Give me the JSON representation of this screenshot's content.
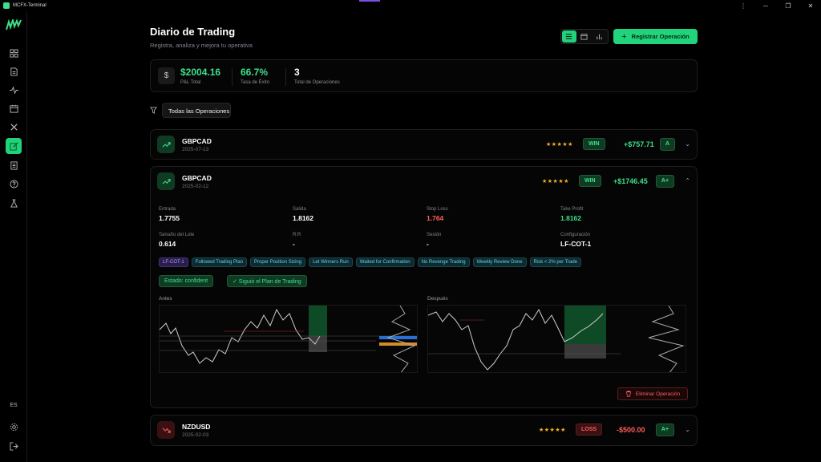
{
  "window": {
    "title": "MCFX-Terminal",
    "controls": [
      "⋮",
      "─",
      "❐",
      "✕"
    ]
  },
  "sidebar": {
    "items": [
      {
        "name": "dashboard-icon"
      },
      {
        "name": "document-icon"
      },
      {
        "name": "activity-icon"
      },
      {
        "name": "calendar-icon"
      },
      {
        "name": "tools-icon"
      },
      {
        "name": "journal-icon",
        "active": true
      },
      {
        "name": "notes-icon"
      },
      {
        "name": "help-icon"
      },
      {
        "name": "lab-icon"
      }
    ],
    "language": "ES"
  },
  "header": {
    "title": "Diario de Trading",
    "subtitle": "Registra, analiza y mejora tu operativa",
    "register_label": "Registrar Operación"
  },
  "stats": {
    "pnl": {
      "value": "$2004.16",
      "label": "P&L Total"
    },
    "winrate": {
      "value": "66.7%",
      "label": "Tasa de Éxito"
    },
    "total": {
      "value": "3",
      "label": "Total de Operaciones"
    }
  },
  "filter": {
    "selected": "Todas las Operaciones"
  },
  "trades": [
    {
      "symbol": "GBPCAD",
      "date": "2025-07-13",
      "stars": "★★★★★",
      "result": "WIN",
      "pnl": "+$757.71",
      "grade": "A",
      "chevron": "⌄"
    },
    {
      "symbol": "GBPCAD",
      "date": "2025-02-12",
      "stars": "★★★★★",
      "result": "WIN",
      "pnl": "+$1746.45",
      "grade": "A+",
      "chevron": "⌃",
      "details": {
        "entry": {
          "label": "Entrada",
          "value": "1.7755"
        },
        "exit": {
          "label": "Salida",
          "value": "1.8162"
        },
        "stop_loss": {
          "label": "Stop Loss",
          "value": "1.764"
        },
        "take_profit": {
          "label": "Take Profit",
          "value": "1.8162"
        },
        "lot_size": {
          "label": "Tamaño del Lote",
          "value": "0.614"
        },
        "rr": {
          "label": "R:R",
          "value": "-"
        },
        "session": {
          "label": "Sesión",
          "value": "-"
        },
        "setup": {
          "label": "Configuración",
          "value": "LF-COT-1"
        },
        "tags": [
          "LF-COT-1",
          "Followed Trading Plan",
          "Proper Position Sizing",
          "Let Winners Run",
          "Waited for Confirmation",
          "No Revenge Trading",
          "Weekly Review Done",
          "Risk < 2% per Trade"
        ],
        "state": "Estado: confident",
        "plan": "✓ Siguió el Plan de Trading",
        "before_label": "Antes",
        "after_label": "Después",
        "delete_label": "Eliminar Operación"
      }
    },
    {
      "symbol": "NZDUSD",
      "date": "2025-02-03",
      "stars": "★★★★★",
      "result": "LOSS",
      "pnl": "-$500.00",
      "grade": "A+",
      "chevron": "⌄"
    }
  ],
  "colors": {
    "accent": "#21d47b",
    "loss": "#ff5c5c",
    "stars": "#f5b324",
    "tag": "#5fd6e6"
  }
}
